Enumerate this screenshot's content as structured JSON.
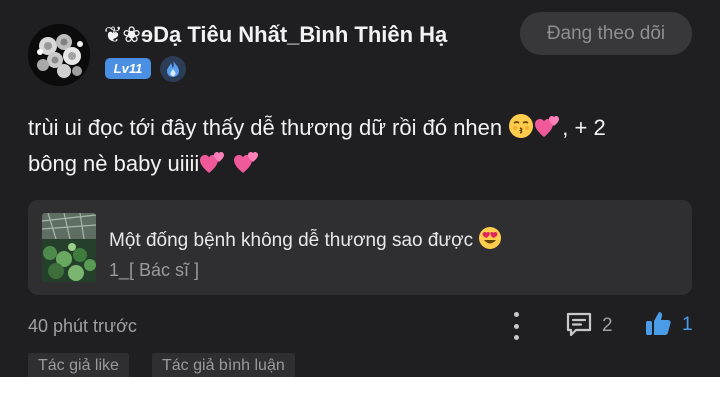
{
  "comment": {
    "author": {
      "name": "❦❀ɘDạ Tiêu Nhất_Bình Thiên Hạ",
      "level": "Lv11",
      "avatar_icon": "flower-bouquet-avatar",
      "rank_icon": "blue-flame-icon"
    },
    "follow_button": "Đang theo dõi",
    "text_line1": "trùi ui đọc tới đây thấy dễ thương dữ rồi đó nhen ",
    "text_line1_tail": ", + 2",
    "text_line2": "bông nè baby uiiii",
    "emojis": [
      "kissing-face-icon",
      "two-hearts-icon"
    ],
    "quoted": {
      "title": "Một đống bệnh không dễ thương sao được ",
      "subtitle": "1_[ Bác sĩ ]",
      "emoji": "heart-eyes-face-icon"
    },
    "timestamp": "40 phút trước",
    "replies": "2",
    "likes": "1",
    "tags": [
      "Tác giả like",
      "Tác giả bình luận"
    ]
  },
  "colors": {
    "background": "#1f1f21",
    "level_badge": "#4a8fe3",
    "like_blue": "#4a9be8",
    "text_primary": "#f2f2f2",
    "text_muted": "#a0a0a4"
  }
}
